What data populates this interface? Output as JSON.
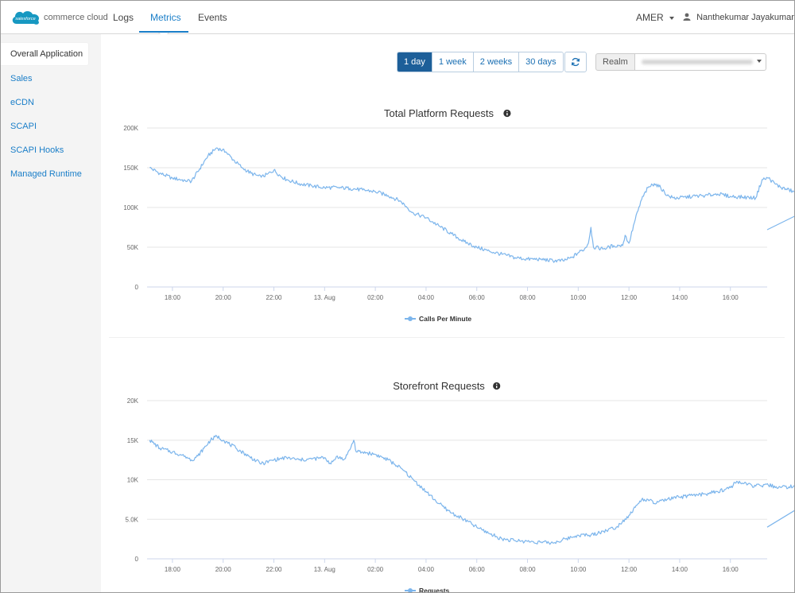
{
  "brand": {
    "logo_badge": "salesforce",
    "logo_text": "commerce cloud"
  },
  "nav": {
    "tabs": [
      {
        "label": "Logs"
      },
      {
        "label": "Metrics"
      },
      {
        "label": "Events"
      }
    ],
    "active_tab": "Metrics",
    "region": "AMER",
    "user": "Nanthekumar Jayakumar"
  },
  "sidebar": {
    "items": [
      {
        "label": "Overall Application"
      },
      {
        "label": "Sales"
      },
      {
        "label": "eCDN"
      },
      {
        "label": "SCAPI"
      },
      {
        "label": "SCAPI Hooks"
      },
      {
        "label": "Managed Runtime"
      }
    ],
    "active_item": "Overall Application"
  },
  "toolbar": {
    "periods": [
      "1 day",
      "1 week",
      "2 weeks",
      "30 days"
    ],
    "active_period": "1 day",
    "refresh_icon": "refresh-icon",
    "realm_label": "Realm"
  },
  "colors": {
    "accent": "#1a7ec8",
    "active_period_bg": "#1d5f99",
    "series": "#7cb5ec",
    "grid": "#e6e6e6"
  },
  "chart_data": [
    {
      "type": "line",
      "title": "Total Platform Requests",
      "title_icon": "info-icon",
      "series": [
        {
          "name": "Calls Per Minute",
          "points": [
            [
              17.1,
              150000
            ],
            [
              17.5,
              143000
            ],
            [
              18.0,
              137000
            ],
            [
              18.5,
              134000
            ],
            [
              18.75,
              133000
            ],
            [
              19.0,
              145000
            ],
            [
              19.4,
              165000
            ],
            [
              19.75,
              175000
            ],
            [
              20.1,
              170000
            ],
            [
              20.4,
              160000
            ],
            [
              20.75,
              150000
            ],
            [
              21.1,
              143000
            ],
            [
              21.5,
              138000
            ],
            [
              21.75,
              142000
            ],
            [
              22.0,
              147000
            ],
            [
              22.25,
              140000
            ],
            [
              22.5,
              135000
            ],
            [
              23.0,
              130000
            ],
            [
              23.5,
              127000
            ],
            [
              24.0,
              125000
            ],
            [
              24.5,
              125000
            ],
            [
              25.0,
              124000
            ],
            [
              25.5,
              122000
            ],
            [
              26.0,
              120000
            ],
            [
              26.5,
              115000
            ],
            [
              27.0,
              108000
            ],
            [
              27.25,
              100000
            ],
            [
              27.5,
              93000
            ],
            [
              28.0,
              87000
            ],
            [
              28.5,
              77000
            ],
            [
              29.0,
              67000
            ],
            [
              29.5,
              57000
            ],
            [
              30.0,
              50000
            ],
            [
              30.5,
              45000
            ],
            [
              31.0,
              41000
            ],
            [
              31.5,
              37000
            ],
            [
              32.0,
              35000
            ],
            [
              32.5,
              35000
            ],
            [
              33.0,
              33000
            ],
            [
              33.4,
              33000
            ],
            [
              33.75,
              37000
            ],
            [
              34.0,
              43000
            ],
            [
              34.25,
              48000
            ],
            [
              34.4,
              55000
            ],
            [
              34.5,
              75000
            ],
            [
              34.6,
              50000
            ],
            [
              35.0,
              48000
            ],
            [
              35.4,
              52000
            ],
            [
              35.6,
              52000
            ],
            [
              35.75,
              52000
            ],
            [
              35.85,
              65000
            ],
            [
              36.0,
              55000
            ],
            [
              36.25,
              85000
            ],
            [
              36.5,
              110000
            ],
            [
              36.75,
              125000
            ],
            [
              37.0,
              130000
            ],
            [
              37.25,
              125000
            ],
            [
              37.5,
              115000
            ],
            [
              37.75,
              112000
            ],
            [
              38.0,
              112000
            ],
            [
              38.5,
              114000
            ],
            [
              39.0,
              115000
            ],
            [
              39.5,
              117000
            ],
            [
              40.0,
              114000
            ],
            [
              40.5,
              113000
            ],
            [
              41.0,
              112000
            ],
            [
              41.25,
              135000
            ],
            [
              41.5,
              137000
            ],
            [
              41.75,
              130000
            ],
            [
              42.0,
              125000
            ],
            [
              42.5,
              120000
            ],
            [
              43.0,
              115000
            ],
            [
              43.25,
              112000
            ],
            [
              43.3,
              85000
            ],
            [
              43.45,
              110000
            ],
            [
              43.55,
              105000
            ],
            [
              43.6,
              72000
            ]
          ]
        }
      ],
      "x_ticks": [
        {
          "x": 18,
          "label": "18:00"
        },
        {
          "x": 20,
          "label": "20:00"
        },
        {
          "x": 22,
          "label": "22:00"
        },
        {
          "x": 24,
          "label": "13. Aug"
        },
        {
          "x": 26,
          "label": "02:00"
        },
        {
          "x": 28,
          "label": "04:00"
        },
        {
          "x": 30,
          "label": "06:00"
        },
        {
          "x": 32,
          "label": "08:00"
        },
        {
          "x": 34,
          "label": "10:00"
        },
        {
          "x": 36,
          "label": "12:00"
        },
        {
          "x": 38,
          "label": "14:00"
        },
        {
          "x": 40,
          "label": "16:00"
        }
      ],
      "y_ticks": [
        {
          "v": 0,
          "label": "0"
        },
        {
          "v": 50000,
          "label": "50K"
        },
        {
          "v": 100000,
          "label": "100K"
        },
        {
          "v": 150000,
          "label": "150K"
        },
        {
          "v": 200000,
          "label": "200K"
        }
      ],
      "xlim": [
        17,
        41.45
      ],
      "ylim": [
        0,
        200000
      ],
      "grid": true,
      "legend_position": "bottom-center"
    },
    {
      "type": "line",
      "title": "Storefront Requests",
      "title_icon": "info-icon",
      "series": [
        {
          "name": "Requests",
          "points": [
            [
              17.1,
              15000
            ],
            [
              17.5,
              14000
            ],
            [
              18.0,
              13500
            ],
            [
              18.5,
              13000
            ],
            [
              18.75,
              12500
            ],
            [
              19.0,
              13000
            ],
            [
              19.25,
              14000
            ],
            [
              19.5,
              15000
            ],
            [
              19.75,
              15500
            ],
            [
              20.0,
              15000
            ],
            [
              20.5,
              14000
            ],
            [
              21.0,
              13000
            ],
            [
              21.5,
              12000
            ],
            [
              22.0,
              12500
            ],
            [
              22.5,
              12800
            ],
            [
              23.0,
              12500
            ],
            [
              23.5,
              12600
            ],
            [
              24.0,
              12800
            ],
            [
              24.25,
              12000
            ],
            [
              24.5,
              13000
            ],
            [
              24.75,
              12500
            ],
            [
              25.0,
              13800
            ],
            [
              25.15,
              15000
            ],
            [
              25.25,
              13500
            ],
            [
              25.5,
              13500
            ],
            [
              26.0,
              13200
            ],
            [
              26.5,
              12500
            ],
            [
              27.0,
              11500
            ],
            [
              27.5,
              10000
            ],
            [
              28.0,
              8500
            ],
            [
              28.5,
              7000
            ],
            [
              29.0,
              5800
            ],
            [
              29.5,
              5000
            ],
            [
              30.0,
              4000
            ],
            [
              30.5,
              3200
            ],
            [
              31.0,
              2500
            ],
            [
              31.5,
              2300
            ],
            [
              32.0,
              2200
            ],
            [
              32.5,
              2100
            ],
            [
              33.0,
              2000
            ],
            [
              33.5,
              2500
            ],
            [
              34.0,
              3000
            ],
            [
              34.5,
              3000
            ],
            [
              35.0,
              3500
            ],
            [
              35.5,
              4000
            ],
            [
              36.0,
              5500
            ],
            [
              36.25,
              6500
            ],
            [
              36.5,
              7500
            ],
            [
              36.75,
              7500
            ],
            [
              37.0,
              7000
            ],
            [
              37.5,
              7500
            ],
            [
              38.0,
              7800
            ],
            [
              38.5,
              8000
            ],
            [
              39.0,
              8200
            ],
            [
              39.5,
              8500
            ],
            [
              40.0,
              9000
            ],
            [
              40.25,
              9800
            ],
            [
              40.5,
              9500
            ],
            [
              41.0,
              9200
            ],
            [
              41.5,
              9300
            ],
            [
              42.0,
              9000
            ],
            [
              42.5,
              9200
            ],
            [
              43.0,
              8900
            ],
            [
              43.4,
              9200
            ],
            [
              43.5,
              8000
            ],
            [
              43.55,
              4000
            ]
          ]
        }
      ],
      "x_ticks": [
        {
          "x": 18,
          "label": "18:00"
        },
        {
          "x": 20,
          "label": "20:00"
        },
        {
          "x": 22,
          "label": "22:00"
        },
        {
          "x": 24,
          "label": "13. Aug"
        },
        {
          "x": 26,
          "label": "02:00"
        },
        {
          "x": 28,
          "label": "04:00"
        },
        {
          "x": 30,
          "label": "06:00"
        },
        {
          "x": 32,
          "label": "08:00"
        },
        {
          "x": 34,
          "label": "10:00"
        },
        {
          "x": 36,
          "label": "12:00"
        },
        {
          "x": 38,
          "label": "14:00"
        },
        {
          "x": 40,
          "label": "16:00"
        }
      ],
      "y_ticks": [
        {
          "v": 0,
          "label": "0"
        },
        {
          "v": 5000,
          "label": "5.0K"
        },
        {
          "v": 10000,
          "label": "10K"
        },
        {
          "v": 15000,
          "label": "15K"
        },
        {
          "v": 20000,
          "label": "20K"
        }
      ],
      "xlim": [
        17,
        41.45
      ],
      "ylim": [
        0,
        20000
      ],
      "grid": true,
      "legend_position": "bottom-center"
    }
  ]
}
